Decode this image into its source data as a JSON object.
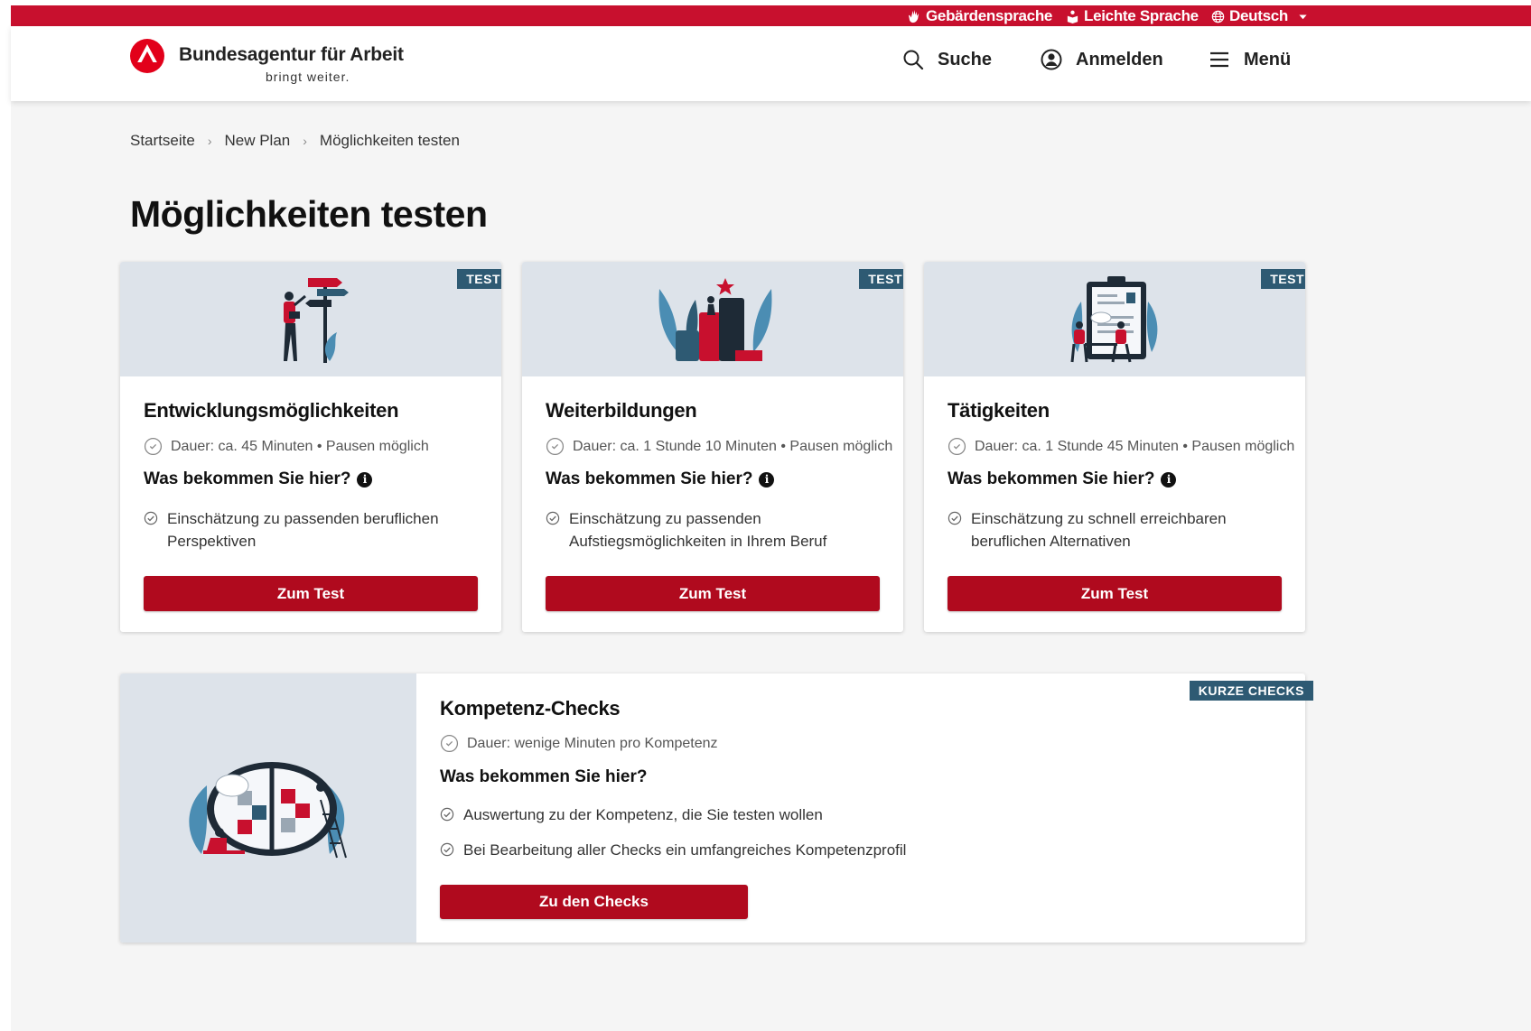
{
  "topbar": {
    "items": [
      {
        "label": "Gebärdensprache",
        "icon": "sign-language-icon"
      },
      {
        "label": "Leichte Sprache",
        "icon": "easy-language-icon"
      },
      {
        "label": "Deutsch",
        "icon": "globe-icon"
      }
    ]
  },
  "header": {
    "brand_name": "Bundesagentur für Arbeit",
    "brand_claim": "bringt weiter.",
    "search_label": "Suche",
    "login_label": "Anmelden",
    "menu_label": "Menü"
  },
  "breadcrumb": [
    "Startseite",
    "New Plan",
    "Möglichkeiten testen"
  ],
  "page_title": "Möglichkeiten testen",
  "cards": [
    {
      "badge": "TEST",
      "title": "Entwicklungsmöglichkeiten",
      "duration": "Dauer: ca. 45 Minuten • Pausen möglich",
      "question": "Was bekommen Sie hier?",
      "benefit": "Einschätzung zu passenden beruflichen Perspektiven",
      "button": "Zum Test"
    },
    {
      "badge": "TEST",
      "title": "Weiterbildungen",
      "duration": "Dauer: ca. 1 Stunde 10 Minuten • Pausen möglich",
      "question": "Was bekommen Sie hier?",
      "benefit": "Einschätzung zu passenden Aufstiegsmöglichkeiten in Ihrem Beruf",
      "button": "Zum Test"
    },
    {
      "badge": "TEST",
      "title": "Tätigkeiten",
      "duration": "Dauer: ca. 1 Stunde 45 Minuten • Pausen möglich",
      "question": "Was bekommen Sie hier?",
      "benefit": "Einschätzung zu schnell erreichbaren beruflichen Alternativen",
      "button": "Zum Test"
    }
  ],
  "wide_card": {
    "badge": "KURZE CHECKS",
    "title": "Kompetenz-Checks",
    "duration": "Dauer: wenige Minuten pro Kompetenz",
    "question": "Was bekommen Sie hier?",
    "benefits": [
      "Auswertung zu der Kompetenz, die Sie testen wollen",
      "Bei Bearbeitung aller Checks ein umfangreiches Kompetenzprofil"
    ],
    "button": "Zu den Checks"
  },
  "colors": {
    "brand_red": "#c8102e",
    "button_red": "#b00a1e",
    "badge_blue": "#2e5a73",
    "media_bg": "#dde3ea"
  }
}
